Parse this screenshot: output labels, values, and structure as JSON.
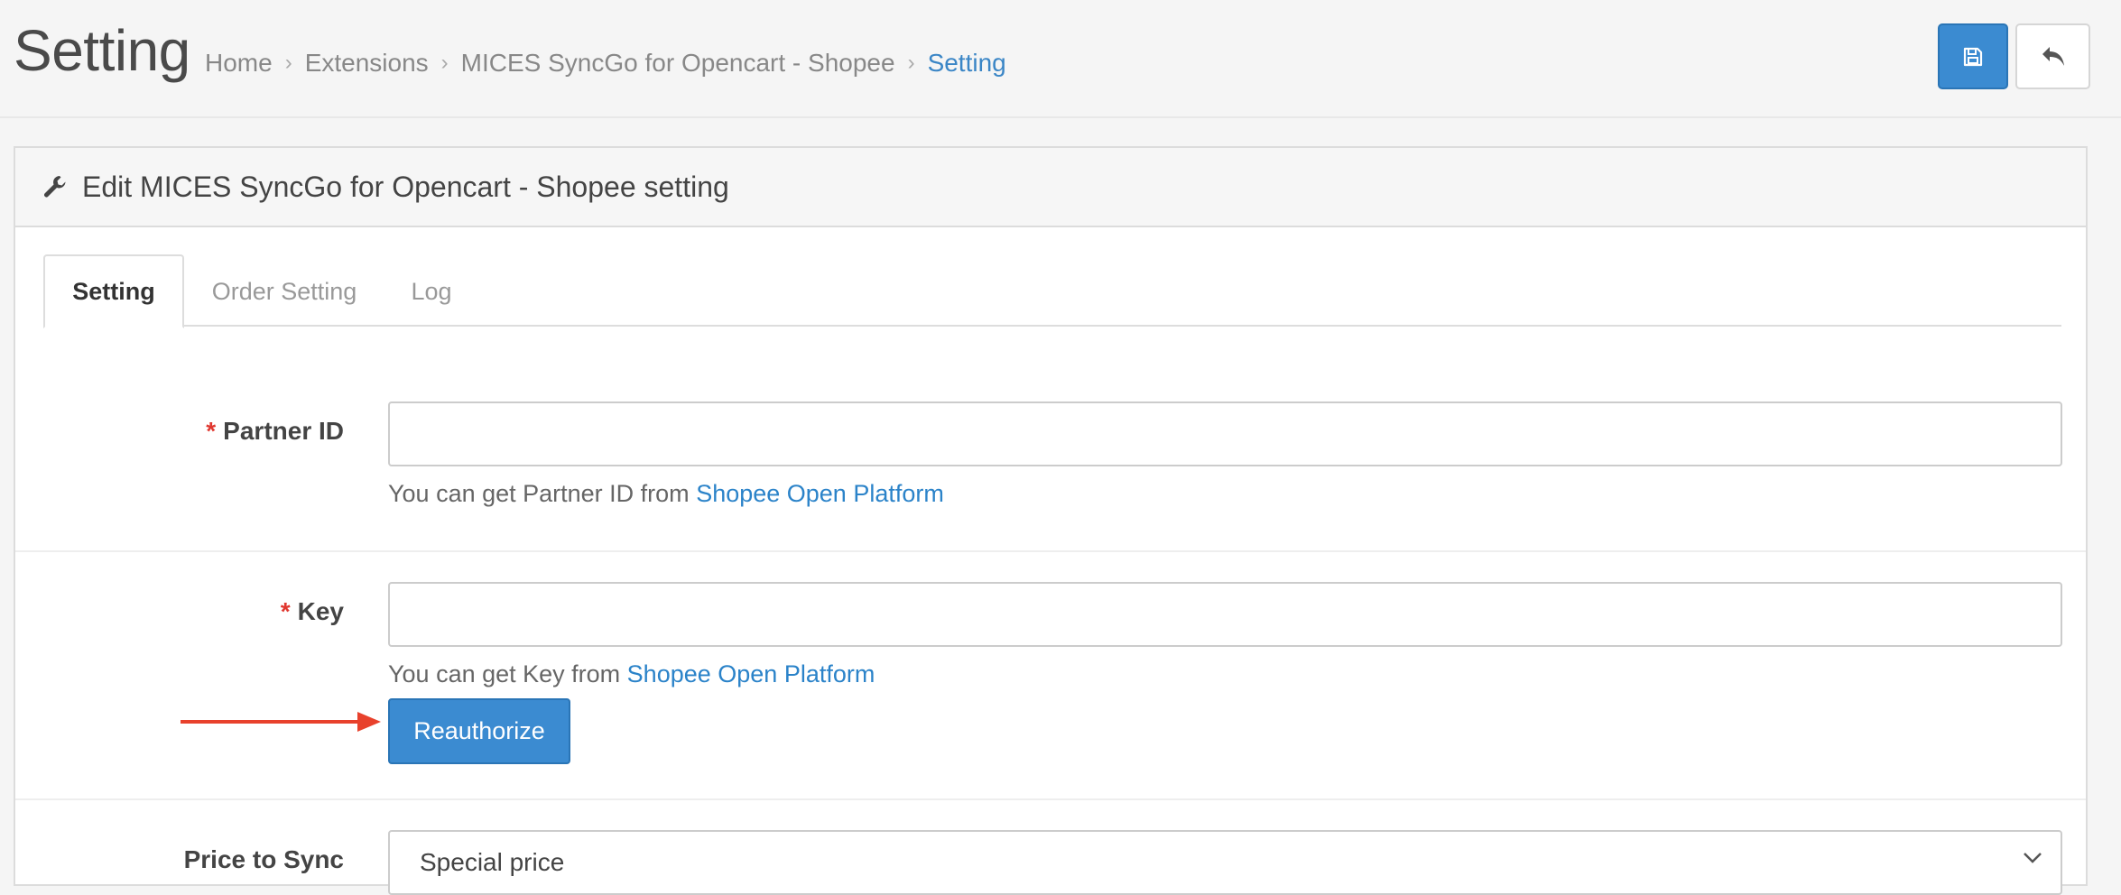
{
  "header": {
    "title": "Setting",
    "breadcrumb": [
      "Home",
      "Extensions",
      "MICES SyncGo for Opencart - Shopee",
      "Setting"
    ],
    "save_icon": "floppy-disk-icon",
    "back_icon": "reply-arrow-icon"
  },
  "panel": {
    "title": "Edit MICES SyncGo for Opencart - Shopee setting",
    "icon": "wrench-icon"
  },
  "tabs": [
    "Setting",
    "Order Setting",
    "Log"
  ],
  "form": {
    "partner_id": {
      "required_mark": "*",
      "label": "Partner ID",
      "value": "",
      "help_text": "You can get Partner ID from ",
      "help_link": "Shopee Open Platform"
    },
    "key": {
      "required_mark": "*",
      "label": "Key",
      "value": "",
      "help_text": "You can get Key from ",
      "help_link": "Shopee Open Platform",
      "button": "Reauthorize"
    },
    "price_to_sync": {
      "label": "Price to Sync",
      "selected": "Special price"
    }
  },
  "colors": {
    "accent": "#3b8bd1",
    "link": "#2b83c9",
    "required": "#e0372f",
    "annotation_arrow": "#e8412c"
  }
}
